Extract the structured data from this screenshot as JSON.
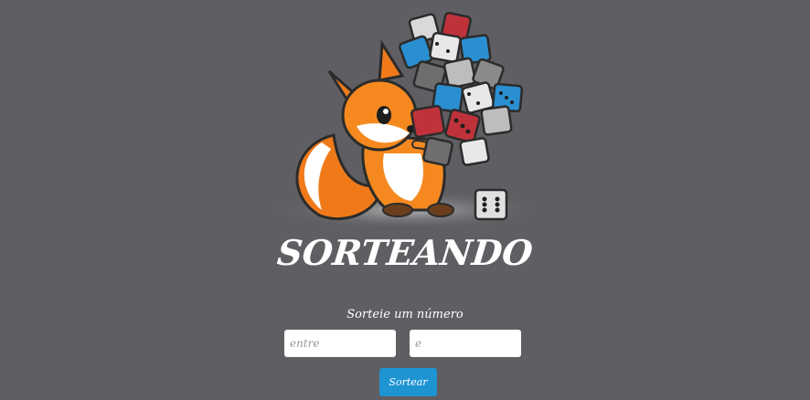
{
  "page": {
    "title": "SORTEANDO",
    "subtitle": "Sorteie um número"
  },
  "form": {
    "from_placeholder": "entre",
    "from_value": "",
    "to_placeholder": "e",
    "to_value": "",
    "submit_label": "Sortear"
  },
  "illustration": {
    "icon": "fox-with-dice-illustration"
  },
  "colors": {
    "background": "#5f5f63",
    "button": "#1e94d2",
    "text": "#ffffff"
  }
}
